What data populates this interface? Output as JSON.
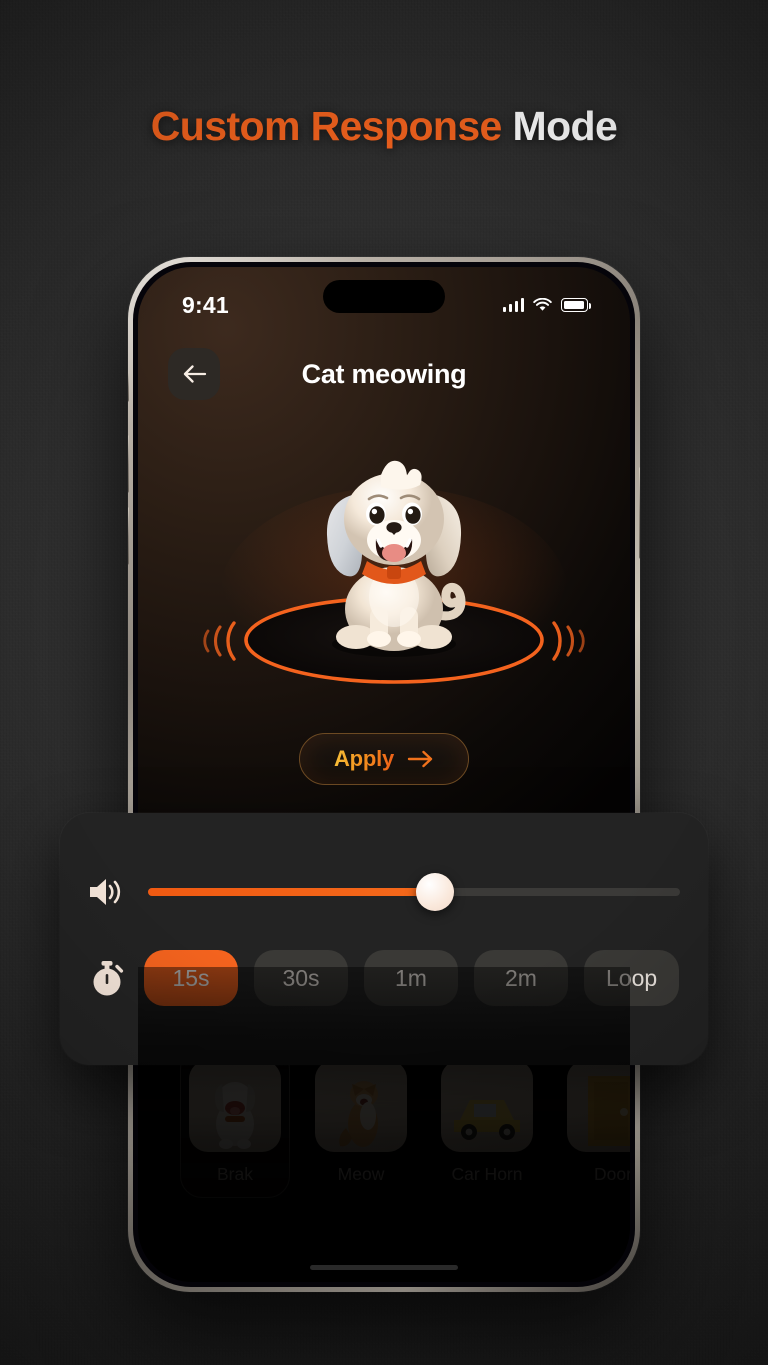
{
  "page": {
    "headline_accent": "Custom Response",
    "headline_plain": "Mode",
    "accent_color": "#F4631E",
    "background_color": "#2b2b2b"
  },
  "phone": {
    "status_bar": {
      "time": "9:41",
      "signal_icon": "cellular-bars-icon",
      "wifi_icon": "wifi-icon",
      "battery_icon": "battery-full-icon",
      "battery_level": 92
    },
    "header": {
      "back_icon": "arrow-left-icon",
      "title": "Cat meowing"
    },
    "hero": {
      "illustration": "puppy-3d-illustration",
      "ring_color": "#F4631E",
      "sound_wave_icon": "sound-waves-icon"
    },
    "apply": {
      "label": "Apply",
      "arrow_icon": "arrow-right-icon"
    },
    "sound_library": {
      "items": [
        {
          "label": "Brak",
          "thumb": "dog-thumbnail",
          "selected": true
        },
        {
          "label": "Meow",
          "thumb": "cat-thumbnail",
          "selected": false
        },
        {
          "label": "Car Horn",
          "thumb": "car-thumbnail",
          "selected": false
        },
        {
          "label": "Door",
          "thumb": "door-thumbnail",
          "selected": false
        }
      ]
    }
  },
  "control_panel": {
    "volume": {
      "icon": "speaker-volume-icon",
      "value_percent": 54,
      "fill_color": "#F4631E",
      "thumb_color": "#FAE8DB"
    },
    "duration": {
      "icon": "stopwatch-icon",
      "selected": "15s",
      "options": [
        {
          "label": "15s",
          "active": true
        },
        {
          "label": "30s",
          "active": false
        },
        {
          "label": "1m",
          "active": false
        },
        {
          "label": "2m",
          "active": false
        },
        {
          "label": "Loop",
          "active": false
        }
      ]
    }
  }
}
